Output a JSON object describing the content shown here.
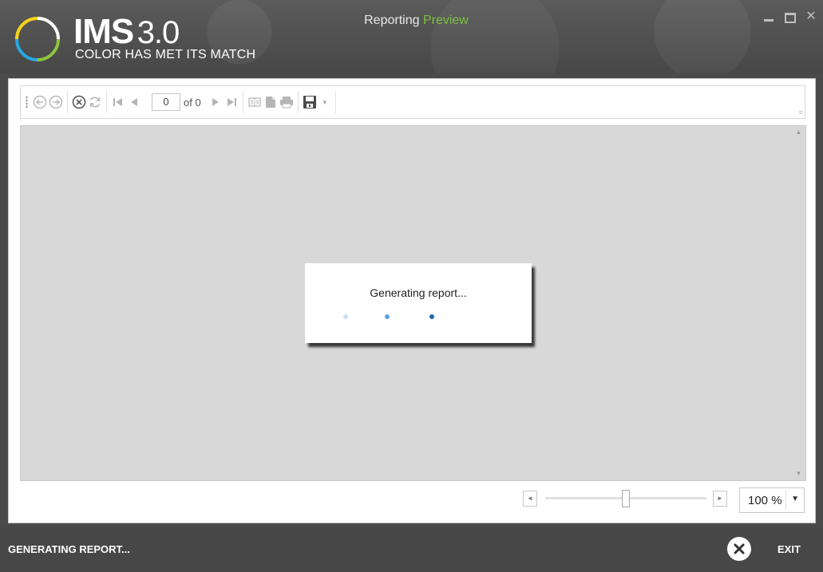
{
  "app": {
    "name": "IMS",
    "version": "3.0",
    "tagline": "COLOR HAS MET ITS MATCH",
    "window_title": "Reporting",
    "window_title_accent": "Preview",
    "accent_color": "#7bc142"
  },
  "toolbar": {
    "icons": [
      "back-icon",
      "forward-icon",
      "stop-icon",
      "refresh-icon",
      "first-page-icon",
      "previous-page-icon",
      "next-page-icon",
      "last-page-icon",
      "page-layout-icon",
      "page-setup-icon",
      "print-icon",
      "save-icon",
      "save-dropdown-icon"
    ],
    "page_input": "0",
    "page_of": "of 0"
  },
  "preview": {
    "loading_message": "Generating report...",
    "dot_colors": [
      "#c9dff5",
      "#5aa2dc",
      "#1c66b6"
    ]
  },
  "zoom": {
    "value": "100 %",
    "slider_level": 0.5
  },
  "footer": {
    "status": "GENERATING REPORT...",
    "exit_label": "EXIT"
  }
}
